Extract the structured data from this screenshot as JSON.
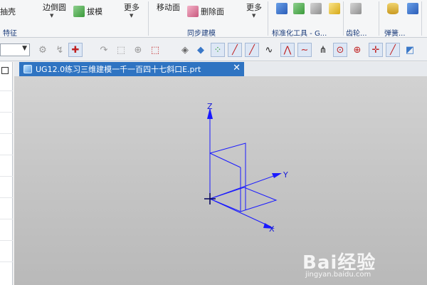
{
  "ribbon": {
    "groups": [
      {
        "label": "特征",
        "items": [
          "抽壳",
          "边倒圆",
          "拔模",
          "更多"
        ]
      },
      {
        "label": "同步建模",
        "items": [
          "移动面",
          "删除面",
          "更多"
        ]
      },
      {
        "label": "标准化工具 - G...",
        "items": []
      },
      {
        "label": "齿轮...",
        "items": []
      },
      {
        "label": "弹簧...",
        "items": []
      }
    ]
  },
  "document": {
    "tab_title": "UG12.0练习三维建模一千一百四十七斜口E.prt",
    "close_glyph": "✕"
  },
  "viewport": {
    "axis_labels": {
      "z": "Z",
      "y": "Y",
      "x": "X"
    },
    "csys_color": "#1a1aff"
  },
  "watermark": {
    "main": "Bai经验",
    "sub": "jingyan.baidu.com"
  }
}
